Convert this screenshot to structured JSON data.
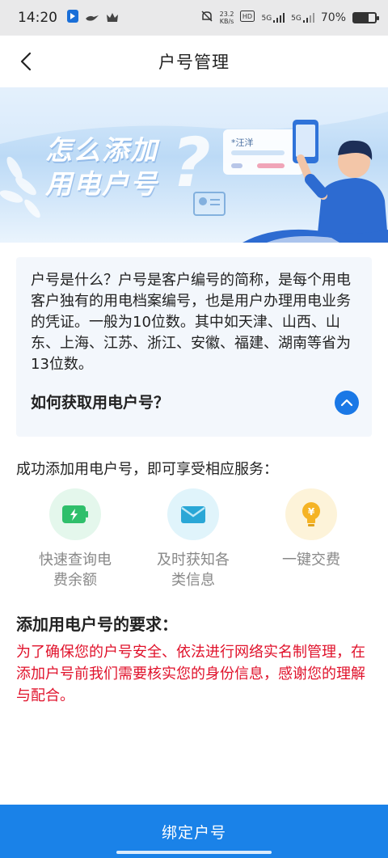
{
  "status_bar": {
    "time": "14:20",
    "net_speed_value": "23.2",
    "net_speed_unit": "KB/s",
    "signal_1": "5G",
    "signal_2": "5G",
    "battery_percent": "70%",
    "battery_level": 0.7
  },
  "nav": {
    "title": "户号管理"
  },
  "banner": {
    "title_line1": "怎么添加",
    "title_line2": "用电户号",
    "card_name": "*汪洋"
  },
  "info": {
    "text": "户号是什么？户号是客户编号的简称，是每个用电客户独有的用电档案编号，也是用户办理用电业务的凭证。一般为10位数。其中如天津、山西、山东、上海、江苏、浙江、安徽、福建、湖南等省为13位数。",
    "question": "如何获取用电户号？"
  },
  "services": {
    "title": "成功添加用电户号，即可享受相应服务：",
    "items": [
      {
        "label": "快速查询电费余额",
        "icon": "battery-icon",
        "color": "#2fbf6b"
      },
      {
        "label": "及时获知各类信息",
        "icon": "envelope-icon",
        "color": "#2aa7d6"
      },
      {
        "label": "一键交费",
        "icon": "lightbulb-icon",
        "color": "#f5b325"
      }
    ]
  },
  "requirements": {
    "title": "添加用电户号的要求：",
    "text": "为了确保您的户号安全、依法进行网络实名制管理，在添加户号前我们需要核实您的身份信息，感谢您的理解与配合。"
  },
  "bind_button": {
    "label": "绑定户号"
  },
  "colors": {
    "accent": "#1a82e8",
    "warning_text": "#e0122b",
    "info_bg": "#f3f7fc"
  }
}
